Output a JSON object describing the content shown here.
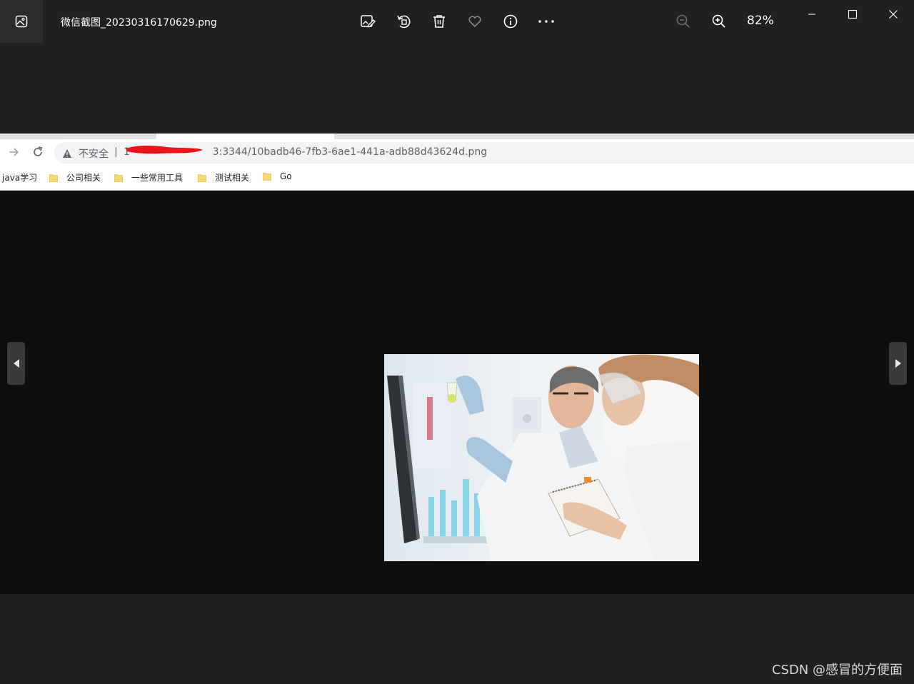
{
  "app": {
    "file_title": "微信截图_20230316170629.png",
    "zoom": "82%",
    "icons": [
      "photos-app-icon",
      "edit-image-icon",
      "rotate-icon",
      "delete-icon",
      "favorite-icon",
      "info-icon",
      "more-icon",
      "zoom-out-icon",
      "zoom-in-icon",
      "minimize-icon",
      "maximize-icon",
      "close-icon",
      "previous-arrow-icon",
      "next-arrow-icon"
    ]
  },
  "browser": {
    "security_label": "不安全",
    "url_visible": "1                          3:3344/10badb46-7fb3-6ae1-441a-adb88d43624d.png",
    "bookmarks": [
      {
        "label": "java学习",
        "folder": false
      },
      {
        "label": "公司相关",
        "folder": true
      },
      {
        "label": "一些常用工具",
        "folder": true
      },
      {
        "label": "测试相关",
        "folder": true
      },
      {
        "label": "Go",
        "folder": true
      }
    ]
  },
  "watermark": "CSDN @感冒的方便面",
  "colors": {
    "redaction": "#e8141a",
    "folder": "#f7d774"
  }
}
